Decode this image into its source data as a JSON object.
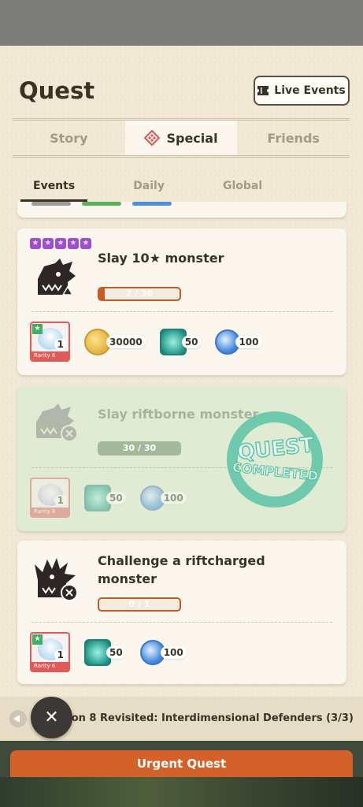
{
  "header": {
    "title": "Quest",
    "live_events_label": "Live Events"
  },
  "tabs": [
    {
      "label": "Story",
      "active": false
    },
    {
      "label": "Special",
      "active": true
    },
    {
      "label": "Friends",
      "active": false
    }
  ],
  "subtabs": [
    {
      "label": "Events",
      "active": true
    },
    {
      "label": "Daily",
      "active": false
    },
    {
      "label": "Global",
      "active": false
    }
  ],
  "quests": [
    {
      "title": "Slay 10★ monster",
      "progress_text": "2 / 30",
      "progress_fraction": 0.067,
      "completed": false,
      "monster_icon": "monster-head-icon",
      "star_rating": 5,
      "rewards": [
        {
          "icon": "rarity-item-icon",
          "label": "Rarity 6",
          "qty": "1"
        },
        {
          "icon": "zenny-coin-icon",
          "qty": "30000"
        },
        {
          "icon": "hunter-medal-icon",
          "qty": "50"
        },
        {
          "icon": "blue-orb-icon",
          "qty": "100"
        }
      ]
    },
    {
      "title": "Slay riftborne monster",
      "progress_text": "30 / 30",
      "progress_fraction": 1.0,
      "completed": true,
      "stamp_line1": "QUEST",
      "stamp_line2": "COMPLETED",
      "monster_icon": "riftborne-monster-icon",
      "rewards": [
        {
          "icon": "rarity-item-icon",
          "label": "Rarity 6",
          "qty": "1"
        },
        {
          "icon": "hunter-medal-icon",
          "qty": "50"
        },
        {
          "icon": "blue-orb-icon",
          "qty": "100"
        }
      ]
    },
    {
      "title_line1": "Challenge a riftcharged",
      "title_line2": "monster",
      "progress_text": "0 / 1",
      "progress_fraction": 0.0,
      "completed": false,
      "monster_icon": "riftcharged-monster-icon",
      "rewards": [
        {
          "icon": "rarity-item-icon",
          "label": "Rarity 6",
          "qty": "1"
        },
        {
          "icon": "hunter-medal-icon",
          "qty": "50"
        },
        {
          "icon": "blue-orb-icon",
          "qty": "100"
        }
      ]
    }
  ],
  "bottom": {
    "event_name": "Season 8 Revisited: Interdimensional Defenders (3/3)",
    "close_label": "✕",
    "urgent_label": "Urgent Quest"
  },
  "colors": {
    "accent": "#c55a22",
    "completed_bg": "#dfecd3",
    "panel_bg": "#f1e8d6"
  }
}
